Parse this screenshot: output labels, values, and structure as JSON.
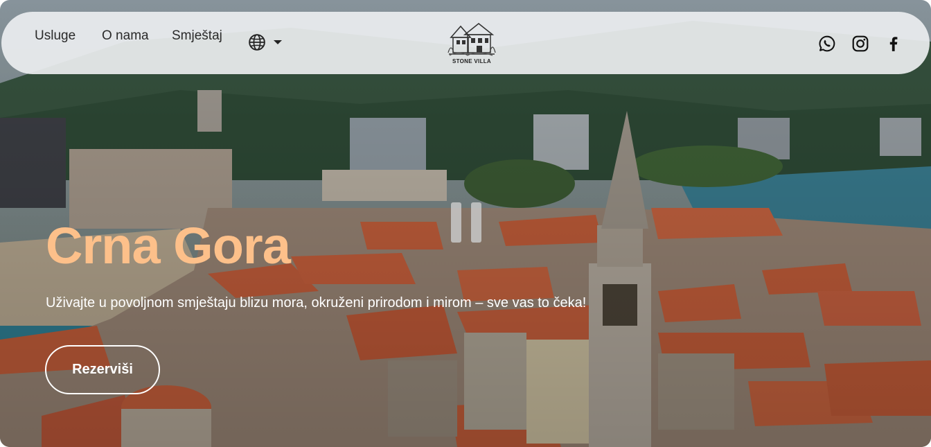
{
  "nav": {
    "links": [
      {
        "label": "Usluge"
      },
      {
        "label": "O nama"
      },
      {
        "label": "Smještaj"
      }
    ],
    "language_icon": "globe-icon",
    "language_dropdown_icon": "caret-down-icon"
  },
  "logo": {
    "text": "STONE VILLA",
    "icon": "villa-house-icon"
  },
  "social": [
    {
      "icon": "whatsapp-icon"
    },
    {
      "icon": "instagram-icon"
    },
    {
      "icon": "facebook-icon"
    }
  ],
  "hero": {
    "title": "Crna Gora",
    "subtitle": "Uživajte u povoljnom smještaju blizu mora, okruženi prirodom i mirom – sve vas to čeka!",
    "cta_label": "Rezerviši",
    "video_control_icon": "pause-icon"
  },
  "colors": {
    "title": "#fdc08a",
    "nav_bg": "#eceef0",
    "roof": "#c8603c",
    "stone": "#a89a8a",
    "sea": "#2f7f94"
  }
}
